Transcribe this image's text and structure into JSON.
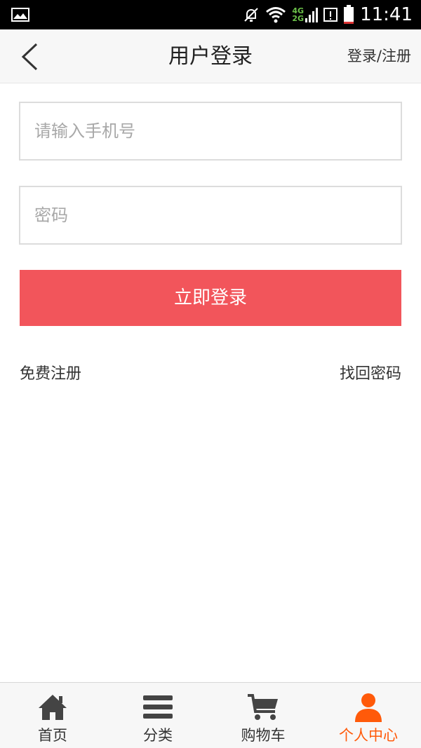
{
  "status_bar": {
    "network_top": "4G",
    "network_bottom": "2G",
    "time": "11:41"
  },
  "header": {
    "title": "用户登录",
    "right_link": "登录/注册",
    "back_icon": "chevron-left-icon"
  },
  "form": {
    "phone_placeholder": "请输入手机号",
    "phone_value": "",
    "password_placeholder": "密码",
    "password_value": "",
    "submit_label": "立即登录"
  },
  "links": {
    "register": "免费注册",
    "forgot_password": "找回密码"
  },
  "tabs": [
    {
      "label": "首页",
      "icon": "home-icon",
      "active": false
    },
    {
      "label": "分类",
      "icon": "menu-icon",
      "active": false
    },
    {
      "label": "购物车",
      "icon": "cart-icon",
      "active": false
    },
    {
      "label": "个人中心",
      "icon": "user-icon",
      "active": true
    }
  ],
  "colors": {
    "accent": "#f2555b",
    "active_tab": "#ff5a0a",
    "icon_gray": "#444444"
  }
}
